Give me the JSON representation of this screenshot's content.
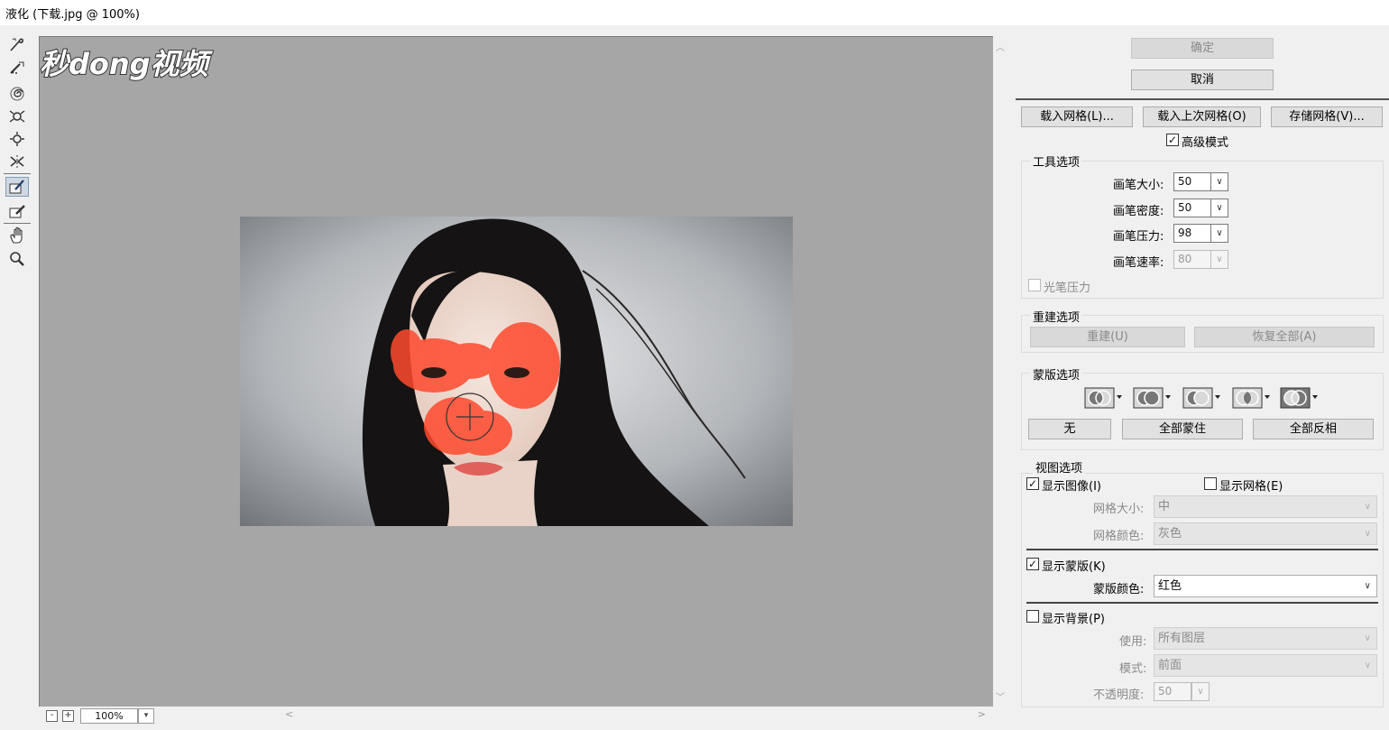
{
  "window": {
    "title": "液化 (下载.jpg @ 100%)"
  },
  "watermark": {
    "text": "秒dong视频"
  },
  "toolbar": {
    "tools": [
      "forward-warp-icon",
      "reconstruct-icon",
      "twirl-icon",
      "pucker-icon",
      "bloat-icon",
      "push-left-icon",
      "freeze-mask-icon",
      "thaw-mask-icon",
      "hand-icon",
      "zoom-icon"
    ],
    "active": "freeze-mask-icon"
  },
  "zoom": {
    "minus": "-",
    "plus": "+",
    "value": "100%"
  },
  "dialog": {
    "ok": "确定",
    "cancel": "取消",
    "load_mesh": "载入网格(L)...",
    "load_last_mesh": "载入上次网格(O)",
    "save_mesh": "存储网格(V)...",
    "advanced_mode": "高级模式"
  },
  "tool_options": {
    "label": "工具选项",
    "brush_size_label": "画笔大小:",
    "brush_size": "50",
    "brush_density_label": "画笔密度:",
    "brush_density": "50",
    "brush_pressure_label": "画笔压力:",
    "brush_pressure": "98",
    "brush_rate_label": "画笔速率:",
    "brush_rate": "80",
    "stylus_pressure": "光笔压力"
  },
  "reconstruct_options": {
    "label": "重建选项",
    "reconstruct": "重建(U)",
    "restore_all": "恢复全部(A)"
  },
  "mask_options": {
    "label": "蒙版选项",
    "none": "无",
    "mask_all": "全部蒙住",
    "invert_all": "全部反相"
  },
  "view_options": {
    "label": "视图选项",
    "show_image": "显示图像(I)",
    "show_mesh": "显示网格(E)",
    "mesh_size_label": "网格大小:",
    "mesh_size": "中",
    "mesh_color_label": "网格颜色:",
    "mesh_color": "灰色",
    "show_mask": "显示蒙版(K)",
    "mask_color_label": "蒙版颜色:",
    "mask_color": "红色",
    "show_backdrop": "显示背景(P)",
    "use_label": "使用:",
    "use": "所有图层",
    "mode_label": "模式:",
    "mode": "前面",
    "opacity_label": "不透明度:",
    "opacity": "50"
  },
  "colors": {
    "mask_red": "#ff4a2e",
    "canvas_gray": "#a6a6a6"
  }
}
